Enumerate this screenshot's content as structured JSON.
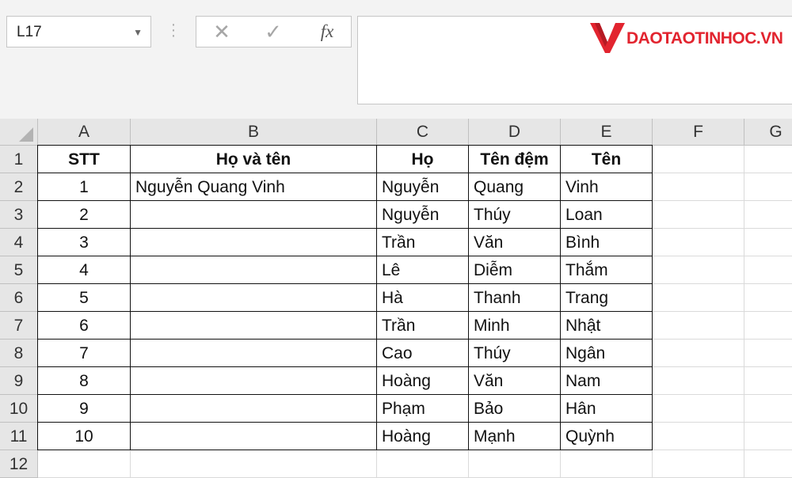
{
  "name_box": {
    "value": "L17"
  },
  "formula_bar": {
    "cancel_glyph": "✕",
    "enter_glyph": "✓",
    "fx_label": "fx",
    "content": ""
  },
  "logo": {
    "text": "DAOTAOTINHOC.VN",
    "color": "#e2242f"
  },
  "columns": [
    "A",
    "B",
    "C",
    "D",
    "E",
    "F",
    "G"
  ],
  "rows": [
    "1",
    "2",
    "3",
    "4",
    "5",
    "6",
    "7",
    "8",
    "9",
    "10",
    "11",
    "12"
  ],
  "table": {
    "headers": [
      "STT",
      "Họ và tên",
      "Họ",
      "Tên đệm",
      "Tên"
    ],
    "body": [
      [
        "1",
        "Nguyễn Quang Vinh",
        "Nguyễn",
        "Quang",
        "Vinh"
      ],
      [
        "2",
        "",
        "Nguyễn",
        "Thúy",
        "Loan"
      ],
      [
        "3",
        "",
        "Trần",
        "Văn",
        "Bình"
      ],
      [
        "4",
        "",
        "Lê",
        "Diễm",
        "Thắm"
      ],
      [
        "5",
        "",
        "Hà",
        "Thanh",
        "Trang"
      ],
      [
        "6",
        "",
        "Trần",
        "Minh",
        "Nhật"
      ],
      [
        "7",
        "",
        "Cao",
        "Thúy",
        "Ngân"
      ],
      [
        "8",
        "",
        "Hoàng",
        "Văn",
        "Nam"
      ],
      [
        "9",
        "",
        "Phạm",
        "Bảo",
        "Hân"
      ],
      [
        "10",
        "",
        "Hoàng",
        "Mạnh",
        "Quỳnh"
      ]
    ]
  }
}
